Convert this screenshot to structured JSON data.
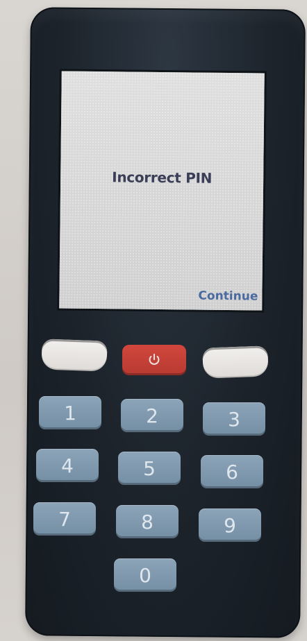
{
  "screen": {
    "message": "Incorrect PIN",
    "right_softkey": "Continue"
  },
  "keypad": {
    "power_icon": "power-icon",
    "digits": [
      "1",
      "2",
      "3",
      "4",
      "5",
      "6",
      "7",
      "8",
      "9",
      "0"
    ]
  },
  "colors": {
    "device_body": "#1c232b",
    "screen_bg": "#d8d8d8",
    "message_text": "#3b3e57",
    "softkey_text": "#4a6aa0",
    "power_key": "#c6403a",
    "number_key": "#7f98ad",
    "soft_key": "#e8e6e3"
  }
}
